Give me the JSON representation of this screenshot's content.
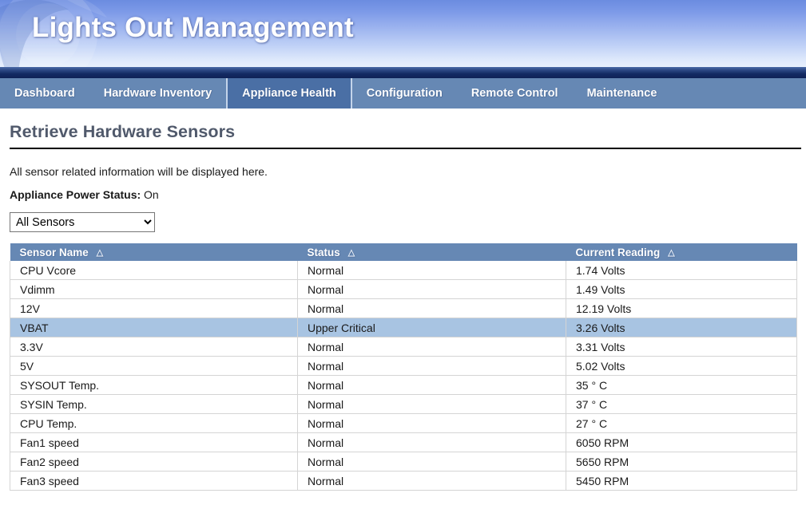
{
  "banner": {
    "title": "Lights Out Management"
  },
  "nav": {
    "items": [
      {
        "label": "Dashboard",
        "active": false
      },
      {
        "label": "Hardware Inventory",
        "active": false
      },
      {
        "label": "Appliance Health",
        "active": true
      },
      {
        "label": "Configuration",
        "active": false
      },
      {
        "label": "Remote Control",
        "active": false
      },
      {
        "label": "Maintenance",
        "active": false
      }
    ]
  },
  "page": {
    "title": "Retrieve Hardware Sensors",
    "description": "All sensor related information will be displayed here.",
    "power_status_label": "Appliance Power Status:",
    "power_status_value": "On"
  },
  "filter": {
    "selected": "All Sensors",
    "options": [
      "All Sensors"
    ]
  },
  "table": {
    "columns": [
      {
        "label": "Sensor Name",
        "sort_icon": "△"
      },
      {
        "label": "Status",
        "sort_icon": "△"
      },
      {
        "label": "Current Reading",
        "sort_icon": "△"
      }
    ],
    "rows": [
      {
        "name": "CPU Vcore",
        "status": "Normal",
        "reading": "1.74 Volts",
        "highlight": false
      },
      {
        "name": "Vdimm",
        "status": "Normal",
        "reading": "1.49 Volts",
        "highlight": false
      },
      {
        "name": "12V",
        "status": "Normal",
        "reading": "12.19 Volts",
        "highlight": false
      },
      {
        "name": "VBAT",
        "status": "Upper Critical",
        "reading": "3.26 Volts",
        "highlight": true
      },
      {
        "name": "3.3V",
        "status": "Normal",
        "reading": "3.31 Volts",
        "highlight": false
      },
      {
        "name": "5V",
        "status": "Normal",
        "reading": "5.02 Volts",
        "highlight": false
      },
      {
        "name": "SYSOUT Temp.",
        "status": "Normal",
        "reading": "35 ° C",
        "highlight": false
      },
      {
        "name": "SYSIN Temp.",
        "status": "Normal",
        "reading": "37 ° C",
        "highlight": false
      },
      {
        "name": "CPU Temp.",
        "status": "Normal",
        "reading": "27 ° C",
        "highlight": false
      },
      {
        "name": "Fan1 speed",
        "status": "Normal",
        "reading": "6050 RPM",
        "highlight": false
      },
      {
        "name": "Fan2 speed",
        "status": "Normal",
        "reading": "5650 RPM",
        "highlight": false
      },
      {
        "name": "Fan3 speed",
        "status": "Normal",
        "reading": "5450 RPM",
        "highlight": false
      }
    ]
  },
  "colors": {
    "nav_bar": "#6688b4",
    "nav_active": "#4a6fa5",
    "table_header": "#6688b4",
    "row_highlight": "#a8c4e2",
    "title_text": "#50596b"
  }
}
